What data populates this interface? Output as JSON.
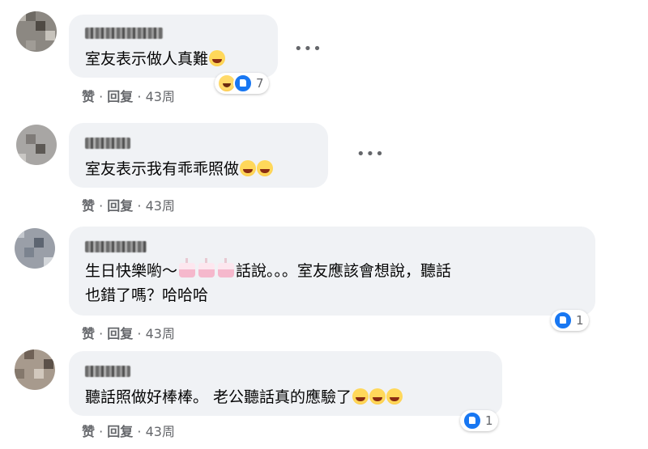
{
  "comments": [
    {
      "text": "室友表示做人真難",
      "actions": {
        "like": "赞",
        "reply": "回复",
        "time": "43周"
      },
      "reaction_count": "7"
    },
    {
      "text": "室友表示我有乖乖照做",
      "actions": {
        "like": "赞",
        "reply": "回复",
        "time": "43周"
      }
    },
    {
      "text_line1_a": "生日快樂喲～",
      "text_line1_b": "話說。。。室友應該會想說，聽話",
      "text_line2": "也錯了嗎？哈哈哈",
      "actions": {
        "like": "赞",
        "reply": "回复",
        "time": "43周"
      },
      "reaction_count": "1"
    },
    {
      "text": "聽話照做好棒棒。 老公聽話真的應驗了",
      "actions": {
        "like": "赞",
        "reply": "回复",
        "time": "43周"
      },
      "reaction_count": "1"
    }
  ],
  "more_glyph": "•••",
  "actions_separator": "·",
  "icons": {
    "haha": "haha-reaction-icon",
    "like": "like-reaction-icon",
    "more": "more-options-icon",
    "cake": "birthday-cake-icon"
  }
}
